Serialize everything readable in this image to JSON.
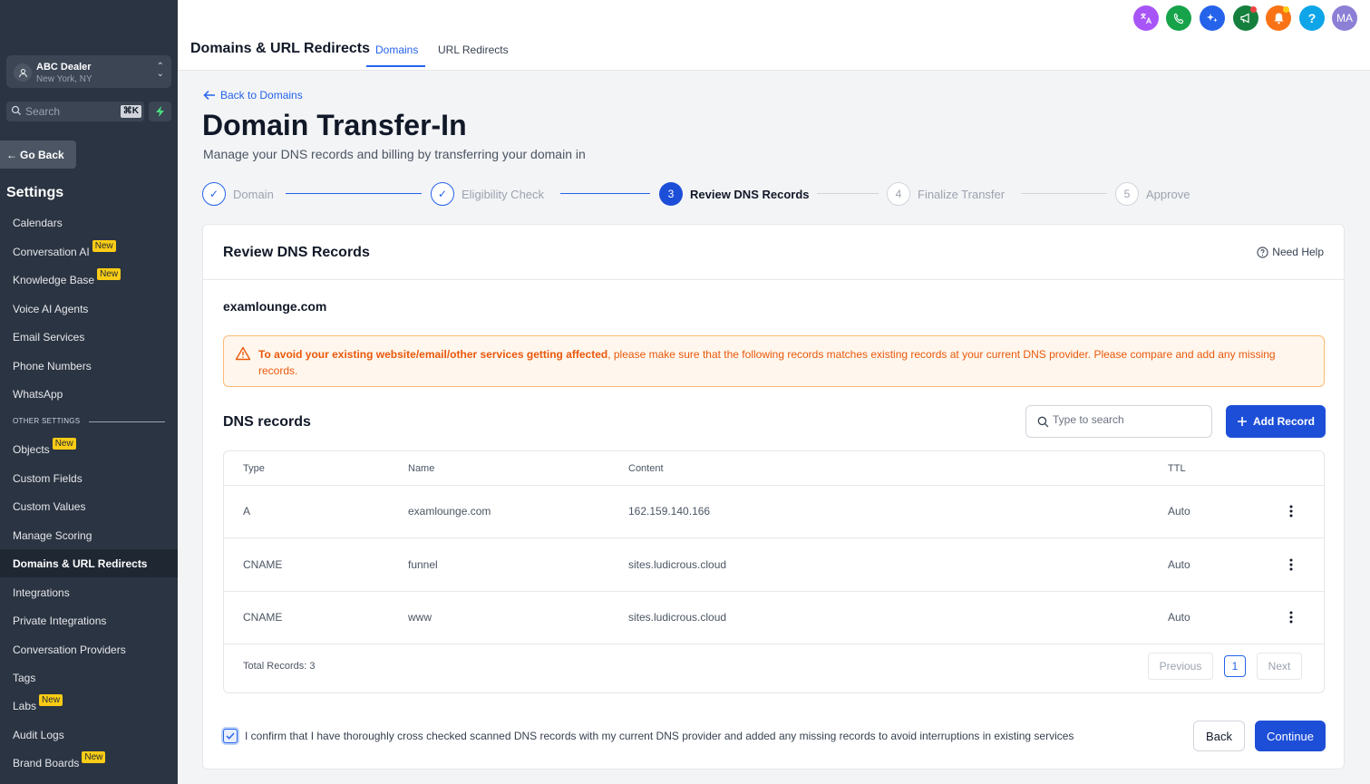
{
  "sidebar": {
    "account": {
      "name": "ABC Dealer",
      "location": "New York, NY"
    },
    "search": {
      "placeholder": "Search",
      "shortcut": "⌘K"
    },
    "go_back": "Go Back",
    "settings_title": "Settings",
    "items": [
      {
        "label": "Calendars",
        "badge": ""
      },
      {
        "label": "Conversation AI",
        "badge": "New"
      },
      {
        "label": "Knowledge Base",
        "badge": "New"
      },
      {
        "label": "Voice AI Agents",
        "badge": ""
      },
      {
        "label": "Email Services",
        "badge": ""
      },
      {
        "label": "Phone Numbers",
        "badge": ""
      },
      {
        "label": "WhatsApp",
        "badge": ""
      }
    ],
    "other_settings_label": "OTHER SETTINGS",
    "other_items": [
      {
        "label": "Objects",
        "badge": "New"
      },
      {
        "label": "Custom Fields",
        "badge": ""
      },
      {
        "label": "Custom Values",
        "badge": ""
      },
      {
        "label": "Manage Scoring",
        "badge": ""
      },
      {
        "label": "Domains & URL Redirects",
        "badge": "",
        "active": true
      },
      {
        "label": "Integrations",
        "badge": ""
      },
      {
        "label": "Private Integrations",
        "badge": ""
      },
      {
        "label": "Conversation Providers",
        "badge": ""
      },
      {
        "label": "Tags",
        "badge": ""
      },
      {
        "label": "Labs",
        "badge": "New"
      },
      {
        "label": "Audit Logs",
        "badge": ""
      },
      {
        "label": "Brand Boards",
        "badge": "New"
      }
    ]
  },
  "topbar": {
    "title": "Domains & URL Redirects",
    "tabs": [
      {
        "label": "Domains",
        "active": true
      },
      {
        "label": "URL Redirects",
        "active": false
      }
    ],
    "avatar_initials": "MA",
    "help_glyph": "?"
  },
  "colors": {
    "accent": "#2563eb",
    "sidebar_bg": "#2b3442",
    "translate": "#a855f7",
    "phone": "#16a34a",
    "ai": "#2563eb",
    "announce": "#15803d",
    "bell": "#f97316",
    "help": "#0ea5e9",
    "avatar": "#8b7fd6"
  },
  "main": {
    "back_link": "Back to Domains",
    "title": "Domain Transfer-In",
    "subtitle": "Manage your DNS records and billing by transferring your domain in",
    "steps": [
      {
        "num": "✓",
        "label": "Domain",
        "state": "done"
      },
      {
        "num": "✓",
        "label": "Eligibility Check",
        "state": "done"
      },
      {
        "num": "3",
        "label": "Review DNS Records",
        "state": "current"
      },
      {
        "num": "4",
        "label": "Finalize Transfer",
        "state": "todo"
      },
      {
        "num": "5",
        "label": "Approve",
        "state": "todo"
      }
    ],
    "card": {
      "title": "Review DNS Records",
      "help": "Need Help",
      "domain": "examlounge.com",
      "warning_bold": "To avoid your existing website/email/other services getting affected",
      "warning_rest": ", please make sure that the following records matches existing records at your current DNS provider. Please compare and add any missing records.",
      "dns_title": "DNS records",
      "search_placeholder": "Type to search",
      "add_record": "Add Record",
      "table": {
        "headers": [
          "Type",
          "Name",
          "Content",
          "TTL"
        ],
        "rows": [
          [
            "A",
            "examlounge.com",
            "162.159.140.166",
            "Auto"
          ],
          [
            "CNAME",
            "funnel",
            "sites.ludicrous.cloud",
            "Auto"
          ],
          [
            "CNAME",
            "www",
            "sites.ludicrous.cloud",
            "Auto"
          ]
        ],
        "total": "Total Records: 3",
        "pagination": {
          "previous": "Previous",
          "page": "1",
          "next": "Next"
        }
      },
      "confirm_text": "I confirm that I have thoroughly cross checked scanned DNS records with my current DNS provider and added any missing records to avoid interruptions in existing services",
      "confirm_checked": true,
      "back_button": "Back",
      "continue_button": "Continue"
    }
  }
}
